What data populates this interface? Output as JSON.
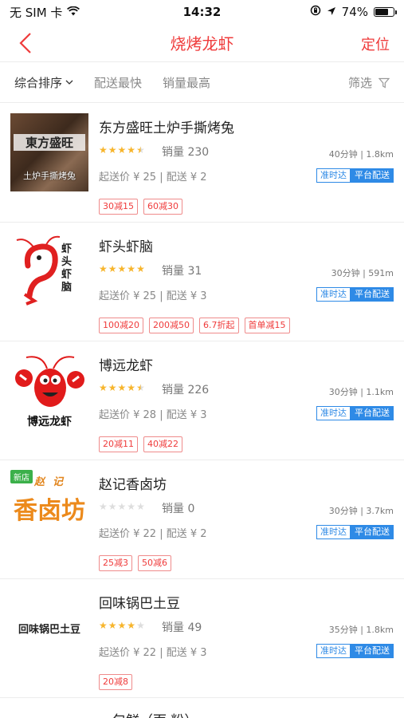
{
  "status_bar": {
    "carrier": "无 SIM 卡",
    "time": "14:32",
    "battery": "74%",
    "battery_level": 0.74
  },
  "nav": {
    "title": "烧烤龙虾",
    "action": "定位"
  },
  "sort": {
    "items": [
      "综合排序",
      "配送最快",
      "销量最高"
    ],
    "filter": "筛选"
  },
  "colors": {
    "accent": "#ef3b3b",
    "blue": "#2e8ae6",
    "star": "#f7b52c",
    "star_empty": "#dddddd"
  },
  "shops": [
    {
      "name": "东方盛旺土炉手撕烤兔",
      "rating": 4.5,
      "sales": "销量 230",
      "meta": "40分钟 | 1.8km",
      "fees": "起送价 ¥ 25 | 配送 ¥ 2",
      "ontime": "准时达",
      "platform": "平台配送",
      "promos": [
        "30减15",
        "60减30"
      ],
      "logo_text_top": "東方盛旺",
      "logo_text_bottom": "土炉手撕烤兔"
    },
    {
      "name": "虾头虾脑",
      "rating": 5,
      "sales": "销量 31",
      "meta": "30分钟 | 591m",
      "fees": "起送价 ¥ 25 | 配送 ¥ 3",
      "ontime": "准时达",
      "platform": "平台配送",
      "promos": [
        "100减20",
        "200减50",
        "6.7折起",
        "首单减15"
      ],
      "logo_text": "虾头虾脑"
    },
    {
      "name": "博远龙虾",
      "rating": 4.5,
      "sales": "销量 226",
      "meta": "30分钟 | 1.1km",
      "fees": "起送价 ¥ 28 | 配送 ¥ 3",
      "ontime": "准时达",
      "platform": "平台配送",
      "promos": [
        "20减11",
        "40减22"
      ],
      "logo_text": "博远龙虾"
    },
    {
      "name": "赵记香卤坊",
      "rating": 0,
      "sales": "销量 0",
      "meta": "30分钟 | 3.7km",
      "fees": "起送价 ¥ 22 | 配送 ¥ 2",
      "ontime": "准时达",
      "platform": "平台配送",
      "promos": [
        "25减3",
        "50减6"
      ],
      "new_tag": "新店",
      "logo_text_top": "赵记",
      "logo_text": "香卤坊"
    },
    {
      "name": "回味锅巴土豆",
      "rating": 4,
      "sales": "销量 49",
      "meta": "35分钟 | 1.8km",
      "fees": "起送价 ¥ 22 | 配送 ¥ 3",
      "ontime": "准时达",
      "platform": "平台配送",
      "promos": [
        "20减8"
      ],
      "logo_text": "回味锅巴土豆"
    }
  ],
  "partial_shop": {
    "name": "一包鲜（面·粉）"
  }
}
